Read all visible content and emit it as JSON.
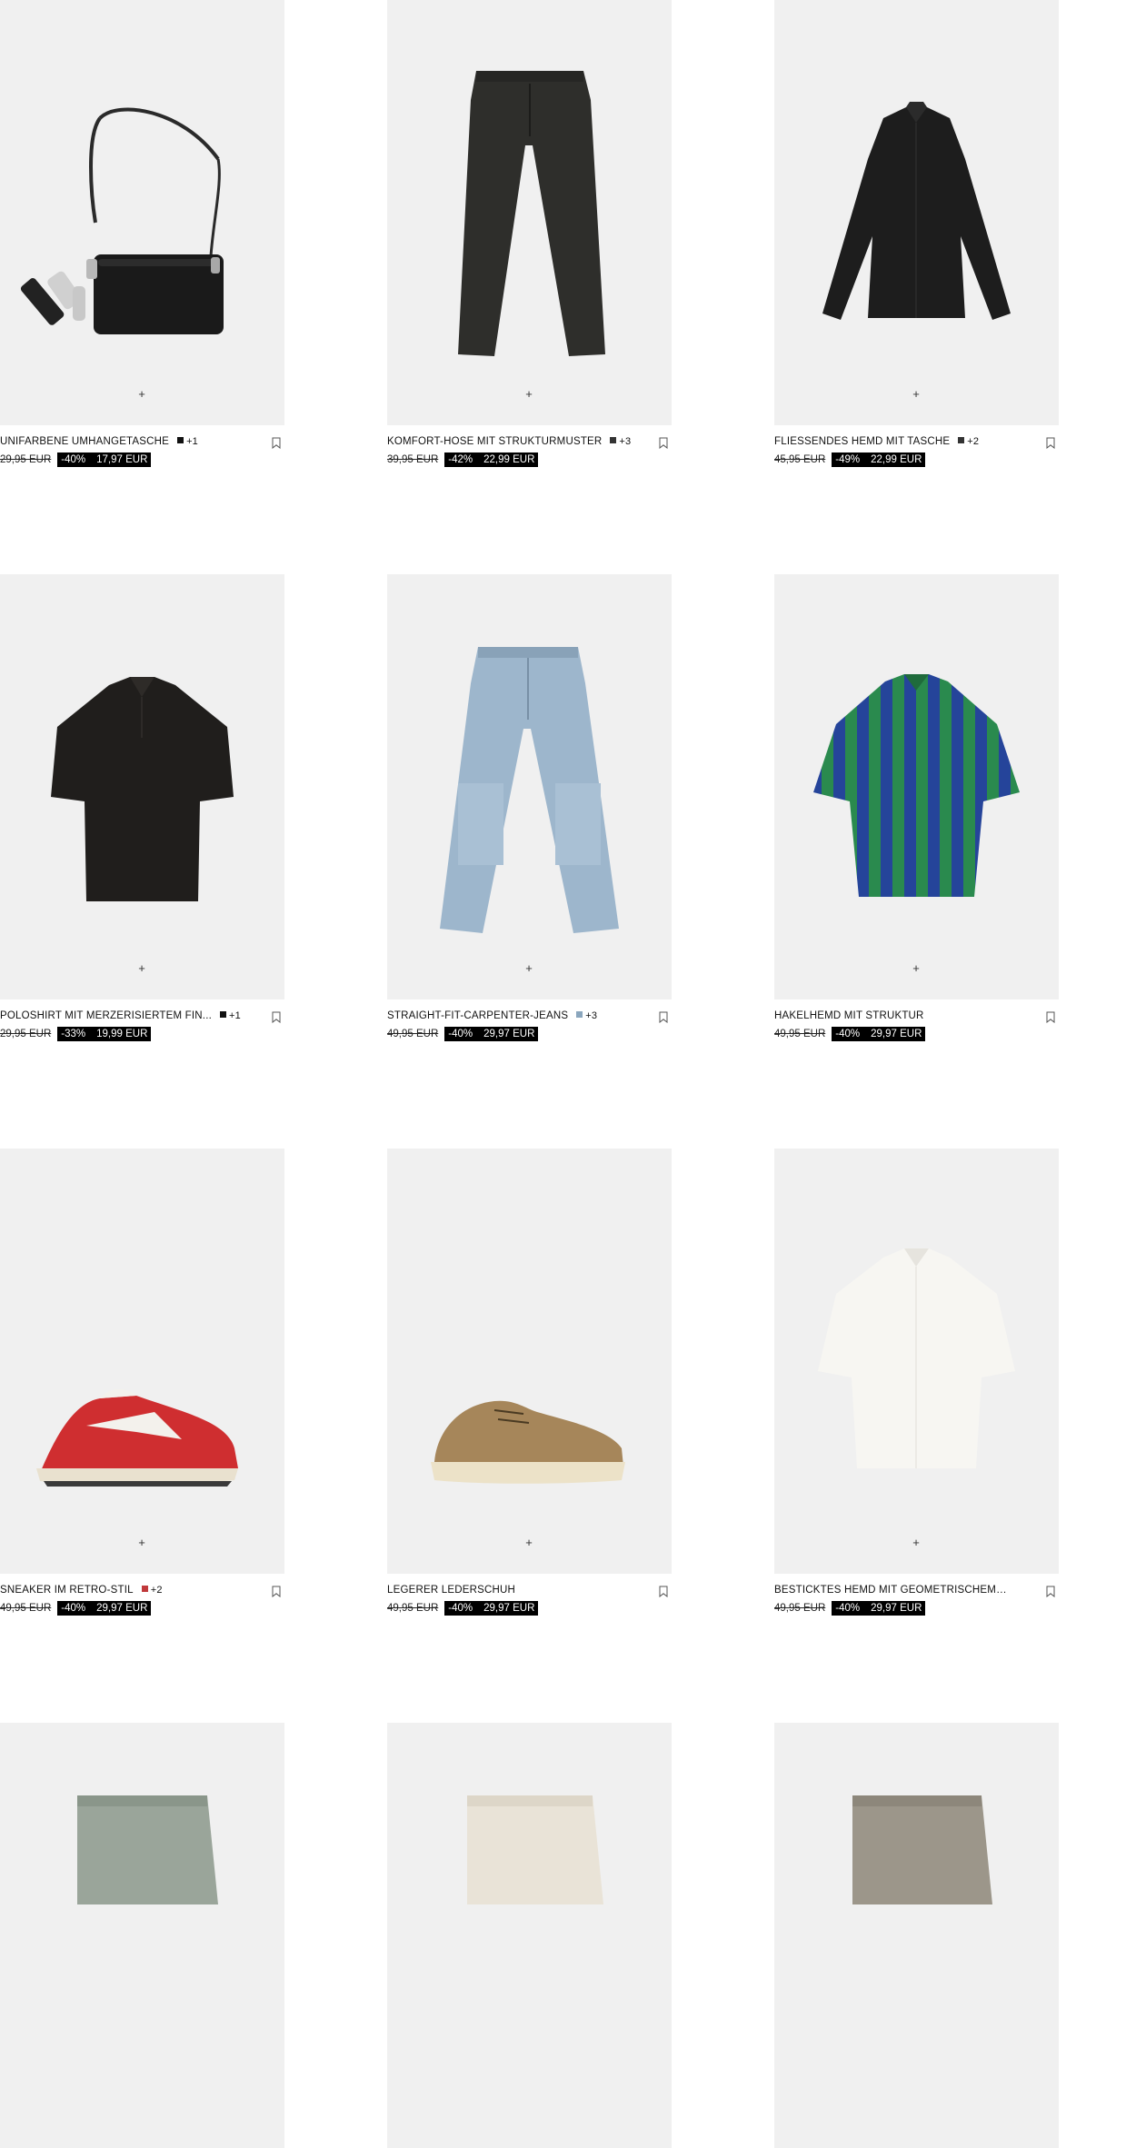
{
  "colors": {
    "tile_background": "#f0f0f0",
    "sale_background": "#000000",
    "sale_text": "#ffffff"
  },
  "icons": {
    "quick_add": "+",
    "wishlist": "bookmark-icon"
  },
  "products": [
    {
      "name": "UNIFARBENE UMHÄNGETASCHE",
      "swatch": "#111111",
      "more_colors": "+1",
      "old_price": "29,95 EUR",
      "discount": "-40%",
      "price": "17,97 EUR",
      "image": "bag"
    },
    {
      "name": "KOMFORT-HOSE MIT STRUKTURMUSTER",
      "swatch": "#333333",
      "more_colors": "+3",
      "old_price": "39,95 EUR",
      "discount": "-42%",
      "price": "22,99 EUR",
      "image": "trousers"
    },
    {
      "name": "FLIESSENDES HEMD MIT TASCHE",
      "swatch": "#333333",
      "more_colors": "+2",
      "old_price": "45,95 EUR",
      "discount": "-49%",
      "price": "22,99 EUR",
      "image": "shirt-black"
    },
    {
      "name": "POLOSHIRT MIT MERZERISIERTEM FIN...",
      "swatch": "#111111",
      "more_colors": "+1",
      "old_price": "29,95 EUR",
      "discount": "-33%",
      "price": "19,99 EUR",
      "image": "polo"
    },
    {
      "name": "STRAIGHT-FIT-CARPENTER-JEANS",
      "swatch": "#8aa6bd",
      "more_colors": "+3",
      "old_price": "49,95 EUR",
      "discount": "-40%",
      "price": "29,97 EUR",
      "image": "jeans"
    },
    {
      "name": "HÄKELHEMD MIT STRUKTUR",
      "swatch": "",
      "more_colors": "",
      "old_price": "49,95 EUR",
      "discount": "-40%",
      "price": "29,97 EUR",
      "image": "crochet"
    },
    {
      "name": "SNEAKER IM RETRO-STIL",
      "swatch": "#c0393b",
      "more_colors": "+2",
      "old_price": "49,95 EUR",
      "discount": "-40%",
      "price": "29,97 EUR",
      "image": "sneaker"
    },
    {
      "name": "LEGERER LEDERSCHUH",
      "swatch": "",
      "more_colors": "",
      "old_price": "49,95 EUR",
      "discount": "-40%",
      "price": "29,97 EUR",
      "image": "suede"
    },
    {
      "name": "BESTICKTES HEMD MIT GEOMETRISCHEM M...",
      "swatch": "",
      "more_colors": "",
      "old_price": "49,95 EUR",
      "discount": "-40%",
      "price": "29,97 EUR",
      "image": "shirt-white"
    },
    {
      "name": "",
      "swatch": "",
      "more_colors": "",
      "old_price": "",
      "discount": "",
      "price": "",
      "image": "shorts-green"
    },
    {
      "name": "",
      "swatch": "",
      "more_colors": "",
      "old_price": "",
      "discount": "",
      "price": "",
      "image": "shorts-cream"
    },
    {
      "name": "",
      "swatch": "",
      "more_colors": "",
      "old_price": "",
      "discount": "",
      "price": "",
      "image": "shorts-taupe"
    }
  ]
}
